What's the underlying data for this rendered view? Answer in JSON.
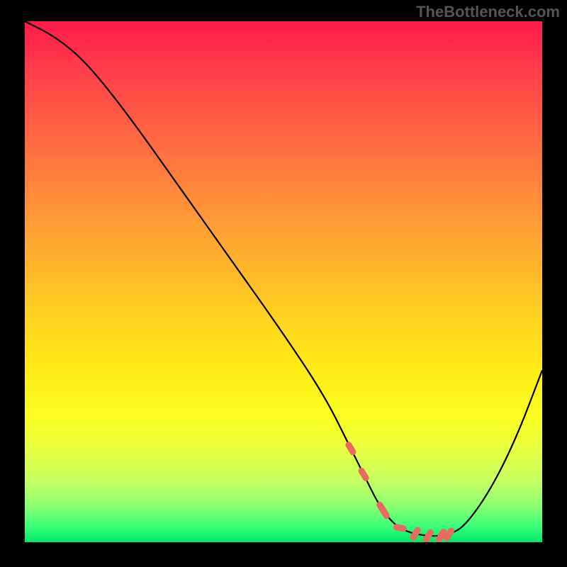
{
  "watermark": "TheBottleneck.com",
  "chart_data": {
    "type": "line",
    "title": "",
    "xlabel": "",
    "ylabel": "",
    "xlim": [
      0,
      100
    ],
    "ylim": [
      0,
      100
    ],
    "series": [
      {
        "name": "bottleneck-curve",
        "x": [
          0,
          6,
          12,
          20,
          30,
          40,
          50,
          58,
          63,
          66,
          68,
          70,
          72,
          74,
          76,
          78,
          80,
          82,
          85,
          90,
          95,
          100
        ],
        "y": [
          100,
          97,
          92,
          82,
          68,
          54,
          40,
          28,
          18,
          12,
          8,
          5,
          3,
          2,
          1.5,
          1.2,
          1.2,
          1.5,
          3,
          10,
          20,
          33
        ]
      }
    ],
    "highlight_range_x": [
      63,
      82
    ],
    "gradient_stops": [
      {
        "pct": 0,
        "color": "#ff1a4a"
      },
      {
        "pct": 50,
        "color": "#ffd51e"
      },
      {
        "pct": 100,
        "color": "#00e865"
      }
    ]
  }
}
